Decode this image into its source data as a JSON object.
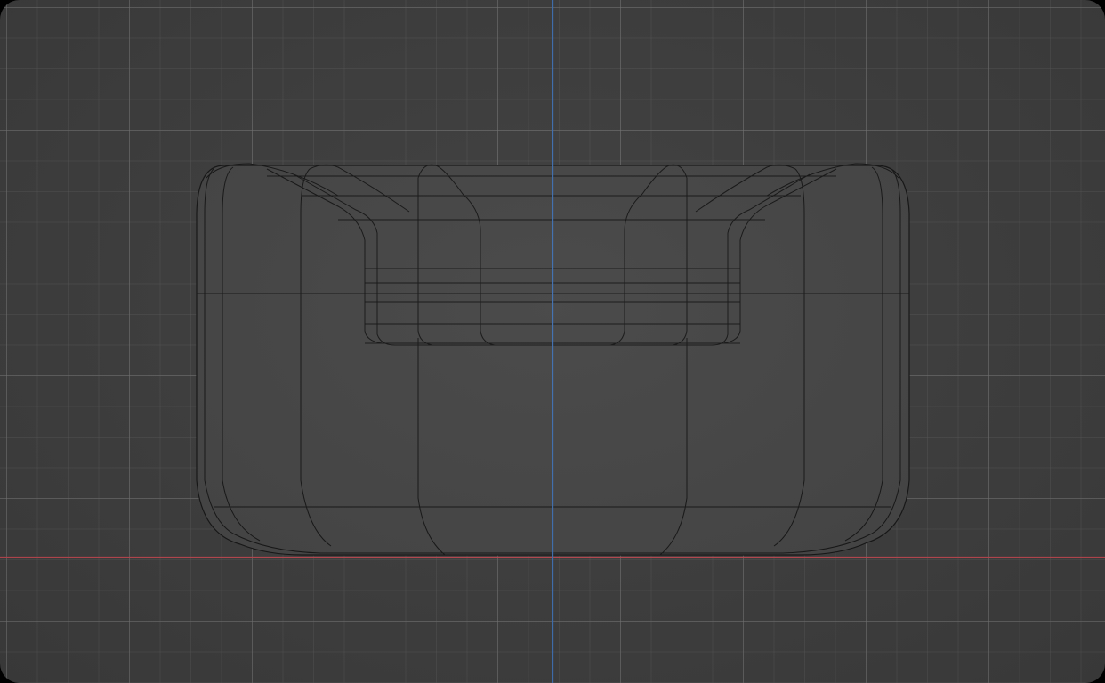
{
  "viewport": {
    "view": "front-orthographic",
    "shading": "wireframe",
    "object": "armchair-mesh"
  },
  "colors": {
    "background": "#3d3d3d",
    "grid_major": "#5a5a5a",
    "grid_minor": "#4a4a4a",
    "x_axis": "#b8474f",
    "z_axis": "#3f6fb0",
    "mesh_fill": "#444444",
    "mesh_edge": "#151515"
  }
}
